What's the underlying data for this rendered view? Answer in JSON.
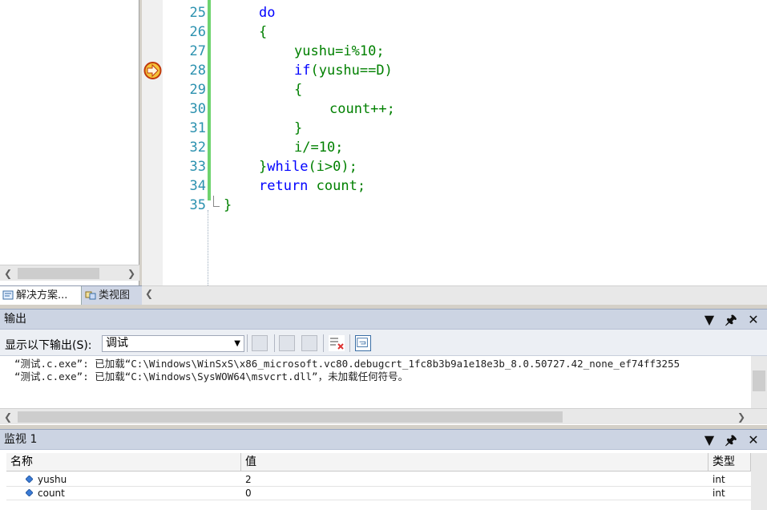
{
  "editor": {
    "lines": [
      {
        "num": "25",
        "text": "do"
      },
      {
        "num": "26",
        "text": "{"
      },
      {
        "num": "27",
        "text": "yushu=i%10;"
      },
      {
        "num": "28",
        "text": "if(yushu==D)"
      },
      {
        "num": "29",
        "text": "{"
      },
      {
        "num": "30",
        "text": "count++;"
      },
      {
        "num": "31",
        "text": "}"
      },
      {
        "num": "32",
        "text": "i/=10;"
      },
      {
        "num": "33",
        "text": "}while(i>0);"
      },
      {
        "num": "34",
        "text": "return count;"
      },
      {
        "num": "35",
        "text": "}"
      }
    ],
    "current_line_marker": "current-statement-arrow-icon"
  },
  "left_tabs": {
    "solution": "解决方案...",
    "classview": "类视图"
  },
  "output": {
    "title": "输出",
    "show_label": "显示以下输出(S):",
    "show_value": "调试",
    "lines": [
      "“测试.c.exe”: 已加载“C:\\Windows\\WinSxS\\x86_microsoft.vc80.debugcrt_1fc8b3b9a1e18e3b_8.0.50727.42_none_ef74ff3255",
      "“测试.c.exe”: 已加载“C:\\Windows\\SysWOW64\\msvcrt.dll”，未加载任何符号。"
    ]
  },
  "watch": {
    "title": "监视 1",
    "columns": [
      "名称",
      "值",
      "类型"
    ],
    "rows": [
      {
        "name": "yushu",
        "value": "2",
        "type": "int"
      },
      {
        "name": "count",
        "value": "0",
        "type": "int"
      }
    ]
  },
  "icons": {
    "dropdown": "dropdown-arrow-icon",
    "pin": "pin-icon",
    "close": "close-icon"
  }
}
